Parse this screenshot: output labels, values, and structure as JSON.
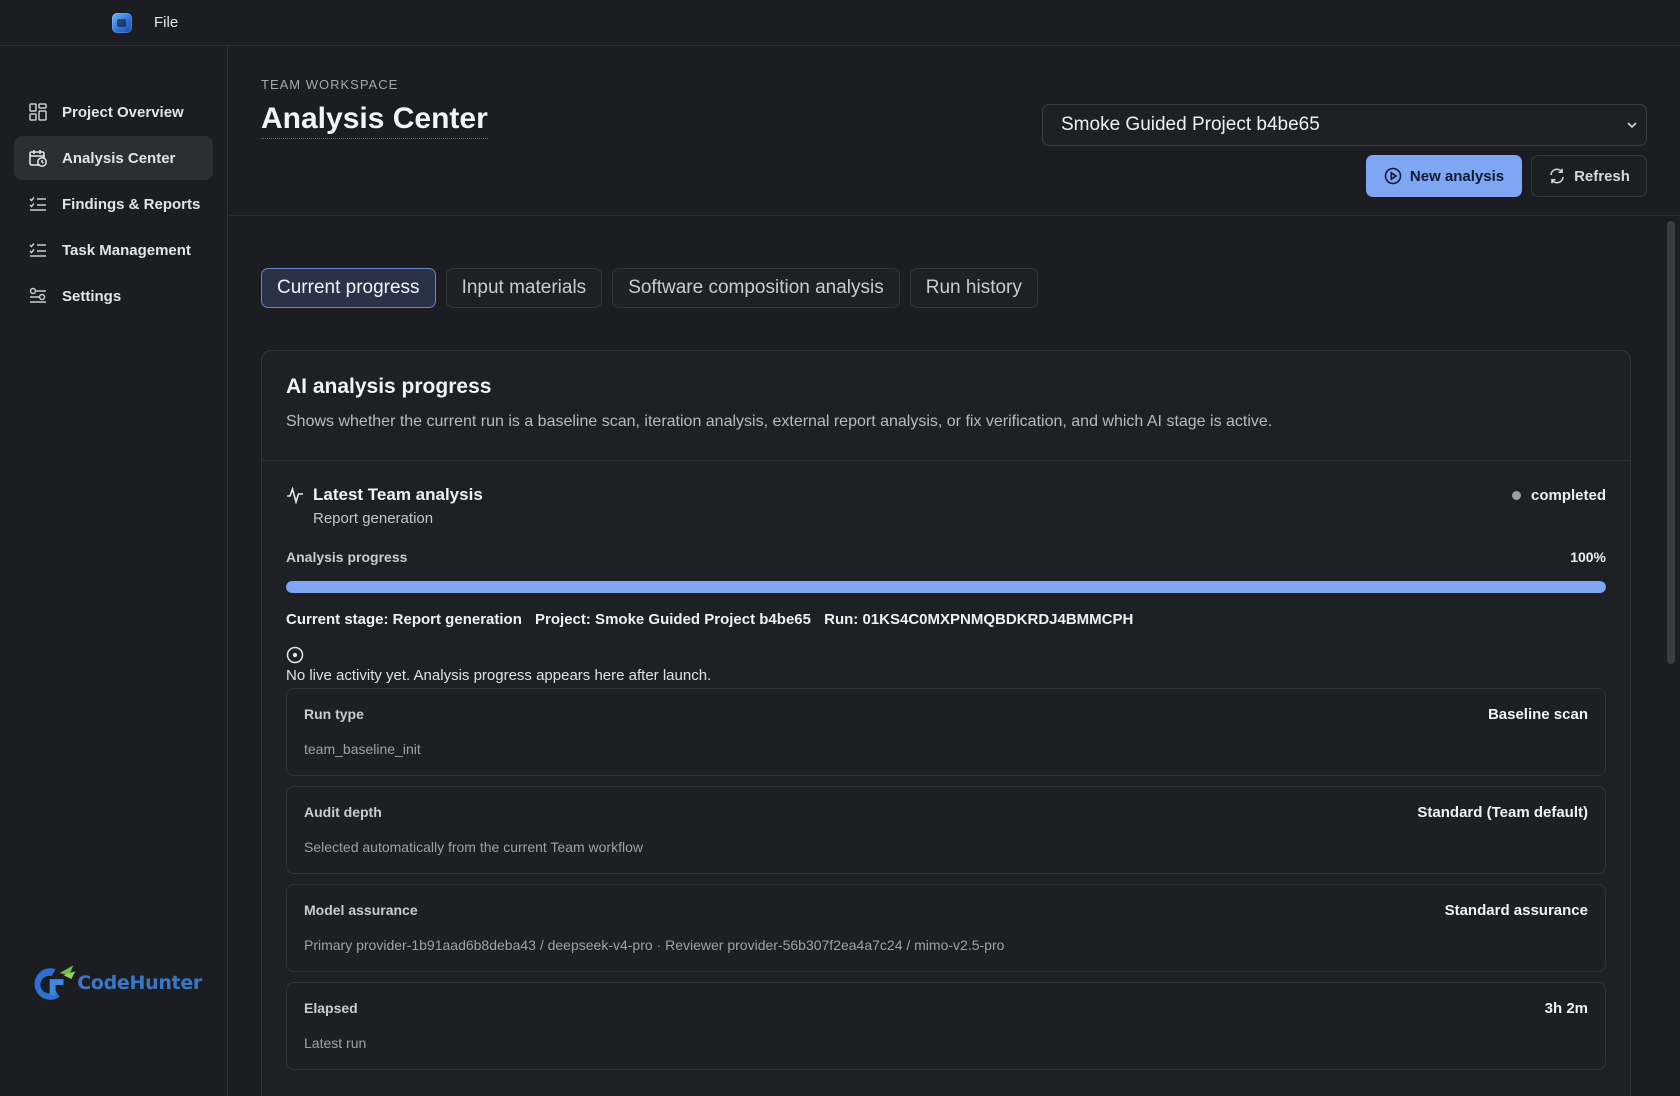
{
  "menu": {
    "file": "File"
  },
  "sidebar": {
    "items": [
      {
        "label": "Project Overview",
        "icon": "grid-icon",
        "active": false
      },
      {
        "label": "Analysis Center",
        "icon": "calendar-clock-icon",
        "active": true
      },
      {
        "label": "Findings & Reports",
        "icon": "checklist-icon",
        "active": false
      },
      {
        "label": "Task Management",
        "icon": "checklist-icon",
        "active": false
      },
      {
        "label": "Settings",
        "icon": "sliders-icon",
        "active": false
      }
    ],
    "logo_text": "CodeHunter"
  },
  "header": {
    "workspace_label": "TEAM WORKSPACE",
    "title": "Analysis Center",
    "project_select": "Smoke Guided Project b4be65",
    "new_analysis": "New analysis",
    "refresh": "Refresh"
  },
  "tabs": [
    "Current progress",
    "Input materials",
    "Software composition analysis",
    "Run history"
  ],
  "card": {
    "title": "AI analysis progress",
    "description": "Shows whether the current run is a baseline scan, iteration analysis, external report analysis, or fix verification, and which AI stage is active.",
    "latest": {
      "title": "Latest Team analysis",
      "subtitle": "Report generation",
      "status": "completed"
    },
    "progress": {
      "label": "Analysis progress",
      "percent_text": "100%",
      "value": 1.0
    },
    "stage_line": {
      "stage": "Current stage: Report generation",
      "project": "Project: Smoke Guided Project b4be65",
      "run": "Run: 01KS4C0MXPNMQBDKRDJ4BMMCPH"
    },
    "live_text": "No live activity yet. Analysis progress appears here after launch.",
    "details": [
      {
        "label": "Run type",
        "value": "Baseline scan",
        "desc": "team_baseline_init"
      },
      {
        "label": "Audit depth",
        "value": "Standard (Team default)",
        "desc": "Selected automatically from the current Team workflow"
      },
      {
        "label": "Model assurance",
        "value": "Standard assurance",
        "desc": "Primary provider-1b91aad6b8deba43 / deepseek-v4-pro · Reviewer provider-56b307f2ea4a7c24 / mimo-v2.5-pro"
      },
      {
        "label": "Elapsed",
        "value": "3h 2m",
        "desc": "Latest run"
      }
    ]
  },
  "colors": {
    "accent": "#7ea6f2",
    "background": "#1b1d22",
    "card": "#1e2025"
  }
}
